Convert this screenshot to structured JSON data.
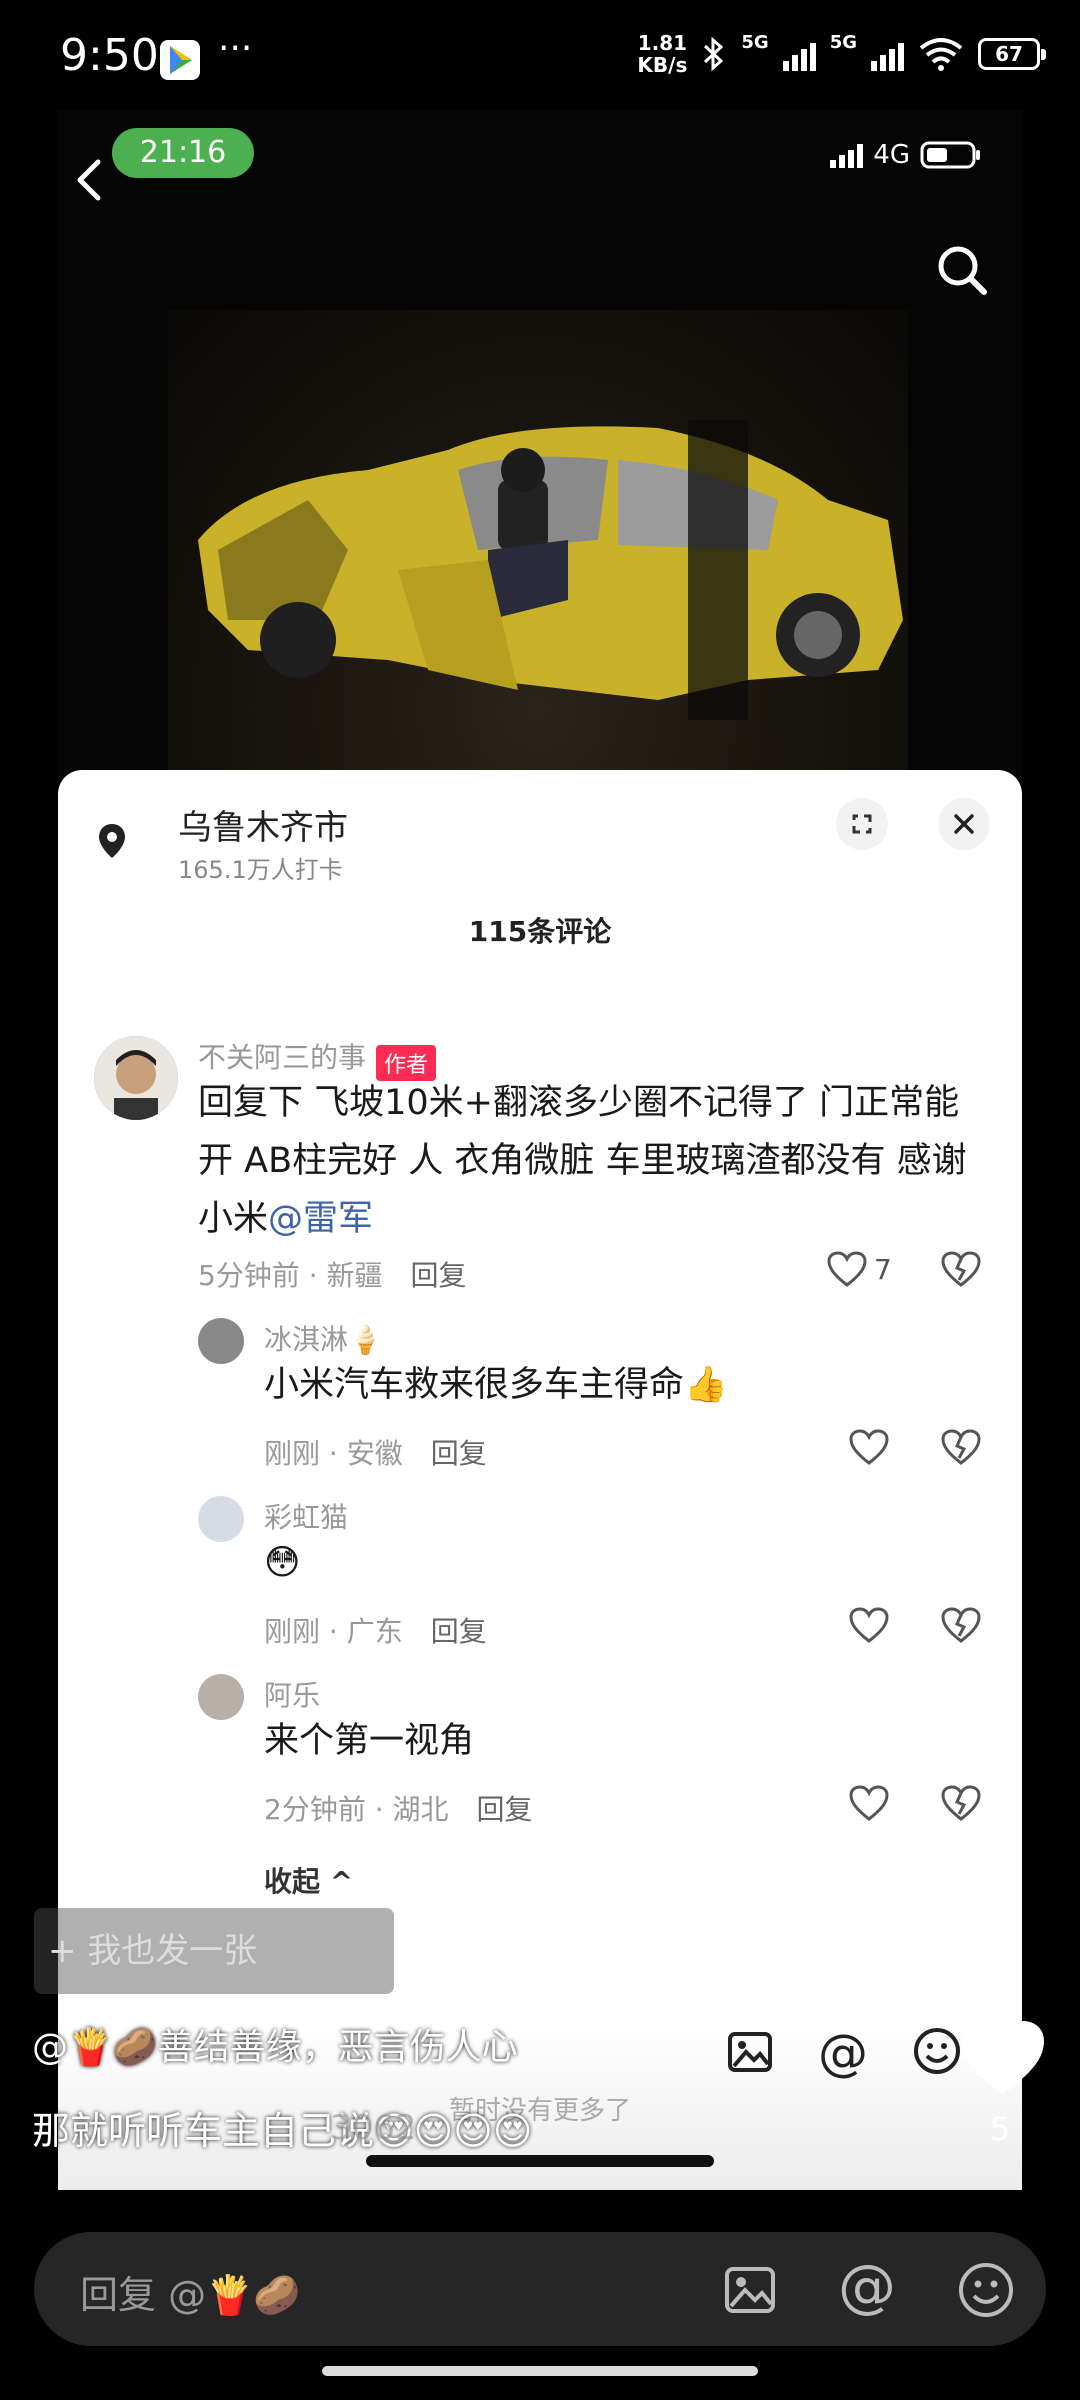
{
  "status_bar": {
    "time": "9:50",
    "dots": "···",
    "net_speed_value": "1.81",
    "net_speed_unit": "KB/s",
    "net1": "5G",
    "net2": "5G",
    "wifi_sub": "6",
    "battery": "67"
  },
  "inner_status": {
    "time_pill": "21:16",
    "network": "4G"
  },
  "location": {
    "name": "乌鲁木齐市",
    "checkins": "165.1万人打卡"
  },
  "comments_count": "115条评论",
  "comments": [
    {
      "user": "不关阿三的事",
      "tag": "作者",
      "text": "回复下 飞坡10米+翻滚多少圈不记得了 门正常能开 AB柱完好 人 衣角微脏 车里玻璃渣都没有 感谢小米",
      "mention": "@雷军",
      "meta": "5分钟前 · 新疆",
      "reply": "回复",
      "likes": "7"
    },
    {
      "user": "冰淇淋🍦",
      "text": "小米汽车救来很多车主得命👍",
      "meta": "刚刚 · 安徽",
      "reply": "回复"
    },
    {
      "user": "彩虹猫",
      "text": "😳",
      "meta": "刚刚 · 广东",
      "reply": "回复"
    },
    {
      "user": "阿乐",
      "text": "来个第一视角",
      "meta": "2分钟前 · 湖北",
      "reply": "回复"
    }
  ],
  "collapse": "收起 ^",
  "no_more": "暂时没有更多了",
  "overlay": {
    "share_button": "+ 我也发一张",
    "danmu1": "@🍟🥔善结善缘，恶言伤人心",
    "danmu2": "那就听听车主自己说😍😍😍😍",
    "ghost": "3062",
    "like_count": "5"
  },
  "reply_input": {
    "placeholder": "回复 @🍟🥔"
  }
}
